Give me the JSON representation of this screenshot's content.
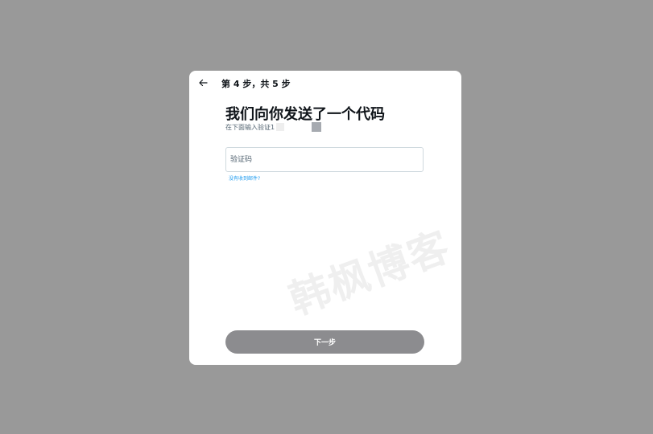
{
  "header": {
    "back_icon": "arrow-left-icon",
    "step_text": "第 4 步，共 5 步"
  },
  "main": {
    "title": "我们向你发送了一个代码",
    "subtitle": "在下面输入验证1",
    "code_input": {
      "placeholder": "验证码",
      "value": ""
    },
    "resend_link": "没有收到邮件?"
  },
  "footer": {
    "next_label": "下一步"
  },
  "watermark": "韩枫博客",
  "colors": {
    "backdrop": "#999999",
    "link": "#1d9bf0",
    "button_disabled": "#8c8c8f",
    "text_primary": "#0f1419"
  }
}
